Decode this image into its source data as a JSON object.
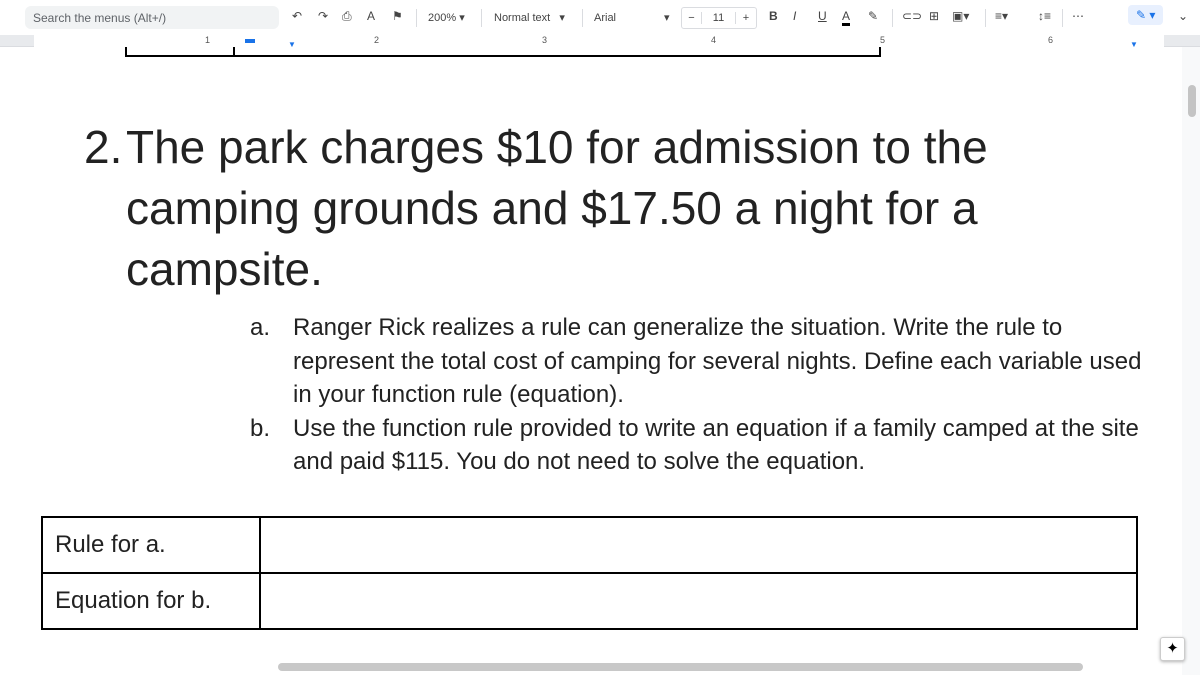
{
  "toolbar": {
    "search_placeholder": "Search the menus (Alt+/)",
    "zoom": "200%",
    "style": "Normal text",
    "font": "Arial",
    "font_size": "11",
    "minus": "−",
    "plus": "+",
    "bold": "B",
    "italic": "I",
    "underline": "U",
    "text_color": "A",
    "more": "⋯"
  },
  "ruler": {
    "numbers": [
      "1",
      "2",
      "3",
      "4",
      "5",
      "6"
    ]
  },
  "question": {
    "number": "2.",
    "text": "The park charges $10 for admission to the camping grounds and $17.50 a night for a campsite.",
    "items": [
      {
        "label": "a.",
        "text": "Ranger Rick realizes a rule can generalize the situation. Write the rule to represent the total cost of camping for several nights. Define each variable used in your function rule (equation)."
      },
      {
        "label": "b.",
        "text": "Use the function rule provided to write an equation if a family camped at the site and paid $115. You do not need to solve the equation."
      }
    ]
  },
  "table": {
    "rows": [
      {
        "label": "Rule for a.",
        "value": ""
      },
      {
        "label": "Equation for b.",
        "value": ""
      }
    ]
  }
}
